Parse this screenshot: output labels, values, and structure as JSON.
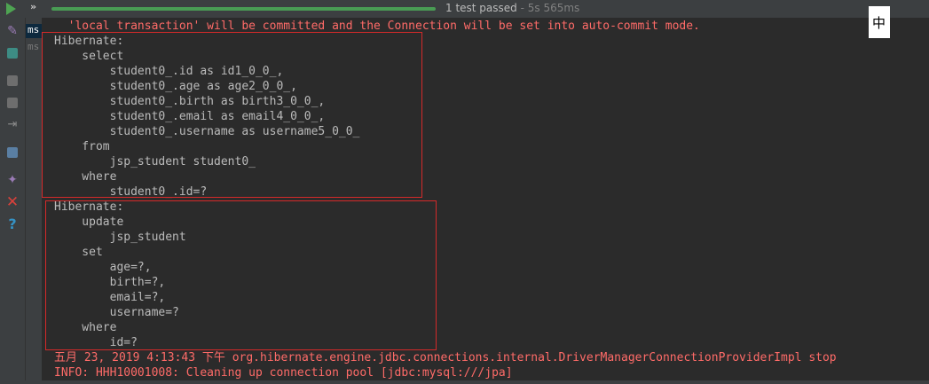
{
  "status": {
    "result": "1 test passed",
    "separator": " - ",
    "duration": "5s 565ms"
  },
  "toolbar": {
    "chevrons": "»"
  },
  "tree": {
    "items": [
      "ms",
      "ms"
    ]
  },
  "console": {
    "lines": [
      {
        "text": "  'local transaction' will be committed and the Connection will be set into auto-commit mode.",
        "color": "red"
      },
      {
        "text": "Hibernate: ",
        "color": "default"
      },
      {
        "text": "    select",
        "color": "default"
      },
      {
        "text": "        student0_.id as id1_0_0_,",
        "color": "default"
      },
      {
        "text": "        student0_.age as age2_0_0_,",
        "color": "default"
      },
      {
        "text": "        student0_.birth as birth3_0_0_,",
        "color": "default"
      },
      {
        "text": "        student0_.email as email4_0_0_,",
        "color": "default"
      },
      {
        "text": "        student0_.username as username5_0_0_",
        "color": "default"
      },
      {
        "text": "    from",
        "color": "default"
      },
      {
        "text": "        jsp_student student0_",
        "color": "default"
      },
      {
        "text": "    where",
        "color": "default"
      },
      {
        "text": "        student0_.id=?",
        "color": "default"
      },
      {
        "text": "Hibernate: ",
        "color": "default"
      },
      {
        "text": "    update",
        "color": "default"
      },
      {
        "text": "        jsp_student",
        "color": "default"
      },
      {
        "text": "    set",
        "color": "default"
      },
      {
        "text": "        age=?,",
        "color": "default"
      },
      {
        "text": "        birth=?,",
        "color": "default"
      },
      {
        "text": "        email=?,",
        "color": "default"
      },
      {
        "text": "        username=?",
        "color": "default"
      },
      {
        "text": "    where",
        "color": "default"
      },
      {
        "text": "        id=?",
        "color": "default"
      },
      {
        "text": "五月 23, 2019 4:13:43 下午 org.hibernate.engine.jdbc.connections.internal.DriverManagerConnectionProviderImpl stop",
        "color": "red"
      },
      {
        "text": "INFO: HHH10001008: Cleaning up connection pool [jdbc:mysql:///jpa]",
        "color": "red"
      }
    ]
  },
  "ime": {
    "glyph": "中"
  },
  "colors": {
    "error_text": "#ff6b68",
    "default_text": "#bbbbbb",
    "progress": "#499c54",
    "highlight_box": "#d42a2a"
  },
  "icons": [
    "run-icon",
    "pin-icon",
    "toggle-icon",
    "stop-icon",
    "dump-icon",
    "import-icon",
    "layout-icon",
    "pin-tab-icon",
    "close-icon",
    "help-icon"
  ]
}
